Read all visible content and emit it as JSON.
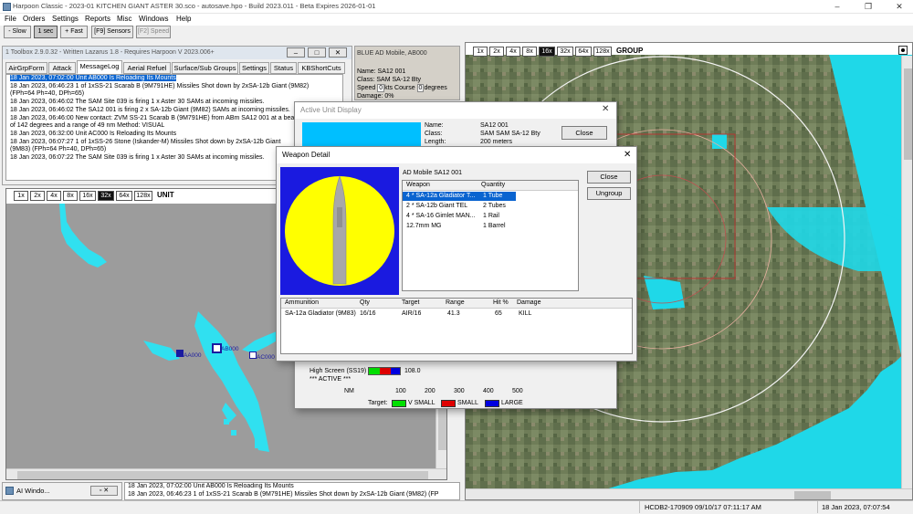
{
  "app": {
    "title": "Harpoon Classic - 2023-01 KITCHEN GIANT ASTER 30.sco - autosave.hpo - Build 2023.011 - Beta Expires 2026-01-01",
    "window_controls": [
      "–",
      "❐",
      "✕"
    ]
  },
  "menu": [
    "File",
    "Orders",
    "Settings",
    "Reports",
    "Misc",
    "Windows",
    "Help"
  ],
  "toolbar": {
    "slow": "- Slow",
    "one_sec": "1 sec",
    "fast": "+ Fast",
    "sensors": "[F9] Sensors",
    "speed": "[F2] Speed"
  },
  "toolbox": {
    "title": "1 Toolbox 2.9.0.32 - Written Lazarus 1.8 - Requires Harpoon V 2023.006+",
    "tabs": [
      "AirGrpForm",
      "Attack",
      "MessageLog",
      "Aerial Refuel",
      "Surface/Sub Groups",
      "Settings",
      "Status",
      "KBShortCuts"
    ],
    "active_tab": "MessageLog",
    "messages": [
      "18 Jan 2023, 07:02:00  Unit AB000 Is Reloading Its Mounts",
      "18 Jan 2023, 06:46:23  1 of 1xSS-21 Scarab B (9M791HE) Missiles Shot down by 2xSA-12b Giant (9M82)",
      "(FPh=64 Ph=40, DPh=65)",
      "18 Jan 2023, 06:46:02  The SAM Site 039 is firing 1 x Aster 30 SAMs at incoming missiles.",
      "18 Jan 2023, 06:46:02  The SA12 001 is firing 2 x SA-12b Giant (9M82) SAMs at incoming missiles.",
      "18 Jan 2023, 06:46:00  New contact: ZVM SS-21 Scarab B (9M791HE) from ABm SA12 001 at a bearing",
      "of 142 degrees and a range of 49 nm Method: VISUAL",
      "18 Jan 2023, 06:32:00  Unit AC000 Is Reloading Its Mounts",
      "18 Jan 2023, 06:07:27  1 of 1xSS-26 Stone (Iskander-M) Missiles Shot down by 2xSA-12b Giant",
      "(9M83) (FPh=64 Ph=40, DPh=65)",
      "18 Jan 2023, 06:07:22  The SAM Site 039 is firing 1 x Aster 30 SAMs at incoming missiles."
    ]
  },
  "unit_info": {
    "title": "BLUE AD Mobile, AB000",
    "name": "Name: SA12 001",
    "class": "Class: SAM SA-12 Bty",
    "speed_label": "Speed",
    "speed": "0",
    "speed_unit": "kts",
    "course_label": "Course",
    "course": "0",
    "course_unit": "degrees",
    "damage_label": "Damage:",
    "damage": "0",
    "damage_unit": "%"
  },
  "unit_map": {
    "zoom_levels": [
      "1x",
      "2x",
      "4x",
      "8x",
      "16x",
      "32x",
      "64x",
      "128x"
    ],
    "active_zoom": "32x",
    "label": "UNIT",
    "units": [
      {
        "label": "AA000",
        "color": "#1a1aa0"
      },
      {
        "label": "AB000",
        "color": "#1a1aa0"
      },
      {
        "label": "AC000",
        "color": "#1a1aa0"
      }
    ]
  },
  "group_map": {
    "zoom_levels": [
      "1x",
      "2x",
      "4x",
      "8x",
      "16x",
      "32x",
      "64x",
      "128x"
    ],
    "active_zoom": "16x",
    "label": "GROUP"
  },
  "active_unit_display": {
    "title": "Active Unit Display",
    "close": "Close",
    "close_x": "✕",
    "rows": [
      {
        "k": "Name:",
        "v": "SA12 001"
      },
      {
        "k": "Class:",
        "v": "SAM  SAM SA-12 Bty"
      },
      {
        "k": "Length:",
        "v": "200 meters"
      }
    ],
    "high_screen_label": "High Screen (SS19)",
    "high_screen_value": "108.0",
    "active_label": "*** ACTIVE ***",
    "nm_label": "NM",
    "range_ticks": [
      "100",
      "200",
      "300",
      "400",
      "500"
    ],
    "target_label": "Target:",
    "target_sizes": [
      {
        "label": "V SMALL",
        "color": "#00e000"
      },
      {
        "label": "SMALL",
        "color": "#e00000"
      },
      {
        "label": "LARGE",
        "color": "#0000e0"
      }
    ]
  },
  "weapon_detail": {
    "title": "Weapon Detail",
    "close_x": "✕",
    "unit_name": "AD Mobile SA12 001",
    "weapon_col": "Weapon",
    "quantity_col": "Quantity",
    "weapons": [
      {
        "name": "4 * SA-12a Gladiator T...",
        "qty": "1 Tube"
      },
      {
        "name": "2 * SA-12b Giant TEL",
        "qty": "2 Tubes"
      },
      {
        "name": "4 * SA-16 Gimlet MAN...",
        "qty": "1 Rail"
      },
      {
        "name": "12.7mm MG",
        "qty": "1 Barrel"
      }
    ],
    "close": "Close",
    "ungroup": "Ungroup",
    "ammo_headers": [
      "Ammunition",
      "Qty",
      "Target",
      "Range",
      "Hit %",
      "Damage"
    ],
    "ammo_rows": [
      [
        "SA-12a Gladiator (9M83)",
        "16/16",
        "AIR/16",
        "41.3",
        "65",
        "KILL"
      ]
    ]
  },
  "bottom_log": {
    "line1": "18 Jan 2023, 07:02:00  Unit AB000 Is Reloading Its Mounts",
    "line2": "18 Jan 2023, 06:46:23  1 of 1xSS-21 Scarab B (9M791HE) Missiles Shot down by 2xSA-12b Giant (9M82) (FP"
  },
  "ai_window": "AI Windo...",
  "status": {
    "code": "HCDB2-170909 09/10/17 07:11:17 AM",
    "datetime": "18 Jan 2023, 07:07:54"
  }
}
